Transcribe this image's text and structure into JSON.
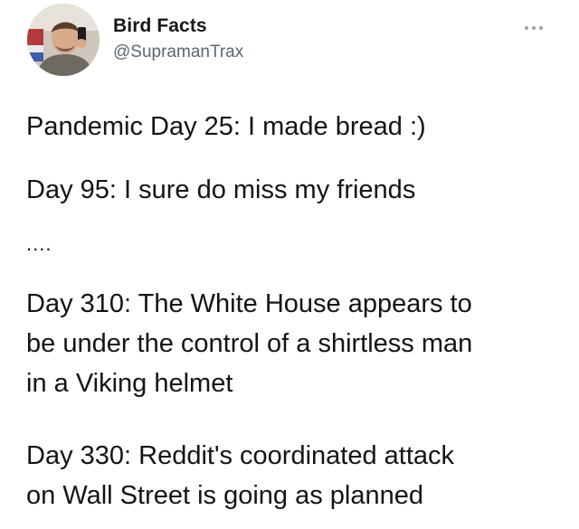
{
  "tweet": {
    "author": {
      "display_name": "Bird Facts",
      "handle": "@SupramanTrax",
      "avatar_icon": "profile-photo"
    },
    "more_icon": "more-horizontal-icon",
    "paragraphs": [
      [
        "Pandemic Day 25: I made bread :)"
      ],
      [
        "Day 95: I sure do miss my friends"
      ],
      [
        "...."
      ],
      [
        "Day 310: The White House appears to",
        "be under the control of a shirtless man",
        "in a Viking helmet"
      ],
      [
        "Day 330: Reddit's coordinated attack",
        "on Wall Street is going as planned"
      ]
    ]
  },
  "colors": {
    "text": "#141414",
    "handle": "#5b6670",
    "background": "#ffffff"
  }
}
